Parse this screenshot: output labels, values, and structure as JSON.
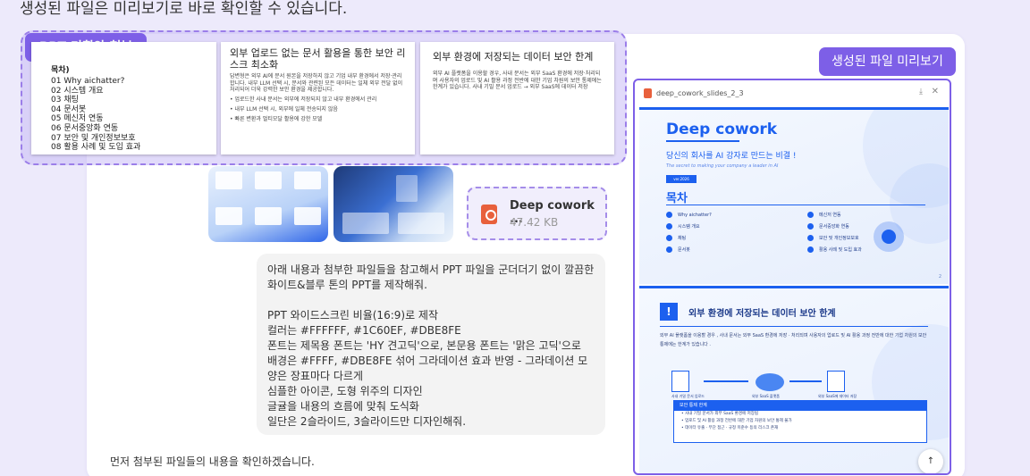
{
  "heading": "생성된 파일은 미리보기로 바로 확인할 수 있습니다.",
  "attachment_label": "PPT 기획안 첨부",
  "slide_toc": {
    "title": "목차)",
    "items": [
      "01 Why aichatter?",
      "02 시스템 개요",
      "03 채팅",
      "04 문서봇",
      "05 메신저 연동",
      "06 문서중앙화 연동",
      "07 보안 및 개인정보보호",
      "08 활용 사례 및 도입 효과"
    ]
  },
  "slide_b": {
    "title": "외부 업로드 없는 문서 활용을 통한 보안 리스크 최소화",
    "paragraph": "답변형은 외부 AI에 문서 원본을 저장하지 않고 기업 내부 환경에서 저장·관리합니다. 내부 LLM 선택 시, 문서와 관련된 모든 데이터는 일체 외부 전달 없이 처리되어 더욱 강력한 보안 환경을 제공합니다.",
    "bullets": [
      "• 업로드한 사내 문서는 외부에 저장되지 않고 내부 환경에서 관리",
      "• 내부 LLM 선택 시, 외부에 일체 전송되지 않음",
      "• 빠른 변환과 멀티모달 활용에 강한 모델"
    ]
  },
  "slide_c": {
    "title": "외부 환경에 저장되는 데이터 보안 한계",
    "paragraph": "외부 AI 플랫폼을 이용할 경우, 사내 문서는 외부 SaaS 환경에 저장·처리되며 사용자의 업로드 및 AI 활용 과정 전반에 대한 기업 차원의 보안 통제에는 한계가 있습니다. 사내 기밀 문서 업로드 → 외부 SaaS에 데이터 저장"
  },
  "file": {
    "name": "Deep cowork ...",
    "size": "47.42 KB"
  },
  "message": {
    "lines": [
      "아래 내용과 첨부한 파일들을 참고해서 PPT 파일을 군더더기 없이 깔끔한 화이트&블루 톤의 PPT를 제작해줘.",
      "",
      "PPT 와이드스크린 비율(16:9)로 제작",
      "컬러는 #FFFFFF, #1C60EF, #DBE8FE",
      "폰트는 제목용 폰트는 'HY 견고딕'으로, 본문용 폰트는 '맑은 고딕'으로",
      "배경은 #FFFF, #DBE8FE 섞어 그라데이션 효과 반영 - 그라데이션 모양은 장표마다 다르게",
      "심플한 아이콘, 도형 위주의 디자인",
      "글귤을 내용의 흐름에 맞춰 도식화",
      "일단은 2슬라이드, 3슬라이드만 디자인해줘."
    ]
  },
  "reply": "먼저 첨부된 파일들의 내용을 확인하겠습니다.",
  "preview": {
    "label": "생성된 파일 미리보기",
    "filename": "deep_cowork_slides_2_3",
    "download_icon": "download-icon",
    "close_icon": "close-icon",
    "slide1": {
      "title": "Deep cowork",
      "subtitle": "당신의 회사를 AI 강자로 만드는 비결 !",
      "english": "The secret to making your company a leader in AI",
      "version": "ver.2026",
      "toc_title": "목차",
      "toc_left": [
        "Why aichatter?",
        "시스템 개요",
        "채팅",
        "문서봇"
      ],
      "toc_right": [
        "메신저 연동",
        "문서중앙화 연동",
        "보안 및 개인정보보호",
        "활용 사례 및 도입 효과"
      ],
      "page": "2"
    },
    "slide2": {
      "title": "외부 환경에 저장되는 데이터 보안 한계",
      "body": "외부 AI 플랫폼을 이용할 경우 , 사내 문서는 외부 SaaS 환경에 저장 · 처리되며 사용자의 업로드 및 AI 활용 과정 전반에 대한 기업 차원의 보안 통제에는 한계가 있습니다 .",
      "flow_labels": [
        "사내 기밀 문서 업로드",
        "외부 SaaS 플랫폼",
        "외부 SaaS에 데이터 저장"
      ],
      "section_title": "보안 통제 한계",
      "section_items": [
        "• 사내 기밀 문서가 외부 SaaS 환경에 저장됨",
        "• 업로드 및 AI 활용 과정 전반에 대한 기업 차원의 보안 통제 불가",
        "• 데이터 유출 · 무단 접근 · 규정 미준수 등의 리스크 존재"
      ]
    },
    "accent": "#1C60EF"
  }
}
